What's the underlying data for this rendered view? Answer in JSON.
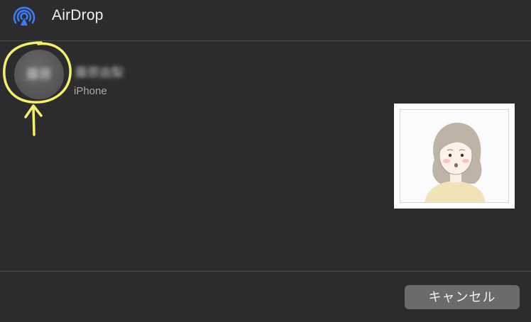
{
  "window": {
    "title": "AirDrop",
    "icon": "airdrop-icon"
  },
  "device": {
    "initials": "藤原",
    "name": "藤原由梨",
    "type": "iPhone",
    "avatar_icon": "avatar"
  },
  "preview": {
    "icon": "portrait-illustration"
  },
  "footer": {
    "cancel_label": "キャンセル"
  },
  "annotation": {
    "color": "#f3f06a",
    "shapes": [
      "circle",
      "arrow-up"
    ]
  }
}
